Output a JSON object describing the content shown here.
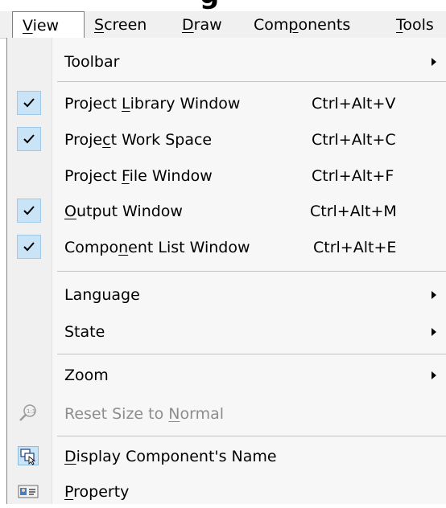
{
  "menubar": {
    "items": [
      {
        "label": "View",
        "active": true
      },
      {
        "label": "Screen"
      },
      {
        "label": "Draw"
      },
      {
        "label": "Components"
      },
      {
        "label": "Tools"
      }
    ]
  },
  "dropdown": {
    "items": [
      {
        "label": "Toolbar",
        "submenu": true
      },
      {
        "label": "Project Library Window",
        "shortcut": "Ctrl+Alt+V",
        "checked": true
      },
      {
        "label": "Project Work Space",
        "shortcut": "Ctrl+Alt+C",
        "checked": true
      },
      {
        "label": "Project File Window",
        "shortcut": "Ctrl+Alt+F",
        "checked": false
      },
      {
        "label": "Output Window",
        "shortcut": "Ctrl+Alt+M",
        "checked": true
      },
      {
        "label": "Component List Window",
        "shortcut": "Ctrl+Alt+E",
        "checked": true
      },
      {
        "label": "Language",
        "submenu": true
      },
      {
        "label": "State",
        "submenu": true
      },
      {
        "label": "Zoom",
        "submenu": true
      },
      {
        "label": "Reset Size to Normal",
        "disabled": true,
        "icon": "zoom-reset-icon"
      },
      {
        "label": "Display Component's Name",
        "icon": "display-name-icon"
      },
      {
        "label": "Property",
        "icon": "property-icon"
      }
    ]
  },
  "colors": {
    "check_bg": "#c9e4f6",
    "menubar_bg": "#f0f0f0",
    "menu_bg": "#f7f7f7",
    "disabled_text": "#8d8d8d"
  }
}
